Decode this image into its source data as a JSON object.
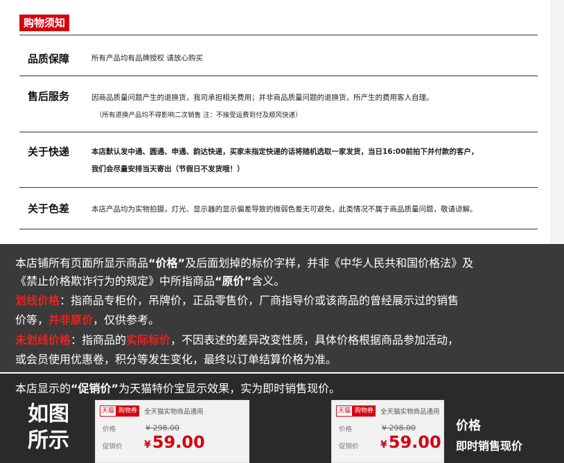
{
  "header": {
    "title": "购物须知"
  },
  "rows": [
    {
      "label": "品质保障",
      "lines": [
        "所有产品均有品牌授权 请放心购买"
      ]
    },
    {
      "label": "售后服务",
      "lines": [
        "因商品质量问题产生的退换货，我司承担相关费用；并非商品质量问题的退换货，所产生的费用客人自理。",
        "（所有退换产品均不得影响二次销售 注：不接受运费到付及顺风快递）"
      ]
    },
    {
      "label": "关于快递",
      "lines": [
        "本店默认发中通、圆通、申通、韵达快递，买家未指定快递的话将随机选取一家发货，当日16:00前拍下并付款的客户，",
        "我们会尽量安排当天寄出（节假日不发货哦！）"
      ]
    },
    {
      "label": "关于色差",
      "lines": [
        "本店产品均为实物拍摄，灯光、显示器的显示偏差导致的微弱色差无可避免，此类情况不属于商品质量问题，敬请谅解。"
      ]
    }
  ],
  "pricing": {
    "p1_a": "本店铺所有页面所显示商品",
    "p1_b": "“价格”",
    "p1_c": "及后面划掉的标价字样，并非《中华人民共和国价格法》及",
    "p2_a": "《禁止价格欺诈行为的规定》中所指商品",
    "p2_b": "“原价”",
    "p2_c": "含义。",
    "p3_a": "划线价格",
    "p3_b": "：指商品专柜价，吊牌价，正品零售价，厂商指导价或该商品的曾经展示过的销售",
    "p4_a": "价等，",
    "p4_b": "并非原价",
    "p4_c": "，仅供参考。",
    "p5_a": "未划线价格",
    "p5_b": "：指商品的",
    "p5_c": "实际标价",
    "p5_d": "，不因表述的差异改变性质，具体价格根据商品参加活动，",
    "p6": "或会员使用优惠卷，积分等发生变化，最终以订单结算价格为准。"
  },
  "promo": {
    "h_a": "本店显示的",
    "h_b": "“促销价”",
    "h_c": "为天猫特价宝显示效果，实为即时销售现价。",
    "left_label_1": "如图",
    "left_label_2": "所示",
    "right_note_1": "价格",
    "right_note_2": "即时销售现价",
    "card": {
      "tmall": "天猫",
      "coupon": "购物券",
      "note": "全天猫实物商品通用",
      "price_label": "价格",
      "promo_label": "促销价",
      "original": "¥ 298.00",
      "currency": "¥",
      "current": "59.00"
    }
  },
  "colors": {
    "accent": "#d7000f",
    "dark_bg": "#3a3a3a"
  }
}
